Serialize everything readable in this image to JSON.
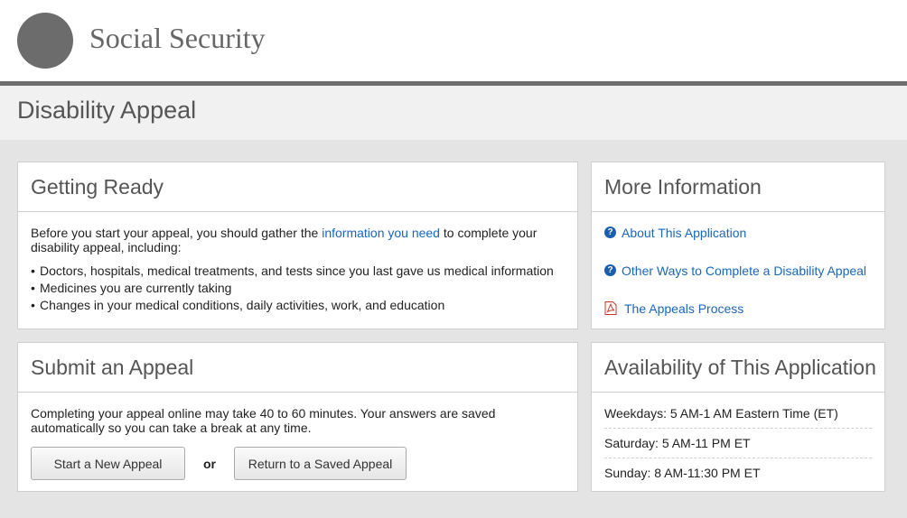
{
  "header": {
    "agency_name": "Social Security",
    "logo_icon": "ssa-seal-logo"
  },
  "page": {
    "title": "Disability Appeal"
  },
  "getting_ready": {
    "heading": "Getting Ready",
    "intro_prefix": "Before you start your appeal, you should gather the ",
    "intro_link": "information you need",
    "intro_suffix": " to complete your disability appeal, including:",
    "items": [
      "Doctors, hospitals, medical treatments, and tests since you last gave us medical information",
      "Medicines you are currently taking",
      "Changes in your medical conditions, daily activities, work, and education"
    ]
  },
  "more_info": {
    "heading": "More Information",
    "links": [
      {
        "label": "About This Application",
        "icon": "help-icon"
      },
      {
        "label": "Other Ways to Complete a Disability Appeal",
        "icon": "help-icon"
      },
      {
        "label": "The Appeals Process",
        "icon": "pdf-icon"
      }
    ]
  },
  "submit": {
    "heading": "Submit an Appeal",
    "text": "Completing your appeal online may take 40 to 60 minutes. Your answers are saved automatically so you can take a break at any time.",
    "start_label": "Start a New Appeal",
    "or_label": "or",
    "return_label": "Return to a Saved Appeal"
  },
  "availability": {
    "heading": "Availability of This Application",
    "rows": [
      "Weekdays: 5 AM-1 AM Eastern Time (ET)",
      "Saturday: 5 AM-11 PM ET",
      "Sunday: 8 AM-11:30 PM ET"
    ]
  },
  "colors": {
    "link": "#1a66b8",
    "header_rule": "#6f6f6f",
    "page_bg": "#e4e4e4"
  }
}
